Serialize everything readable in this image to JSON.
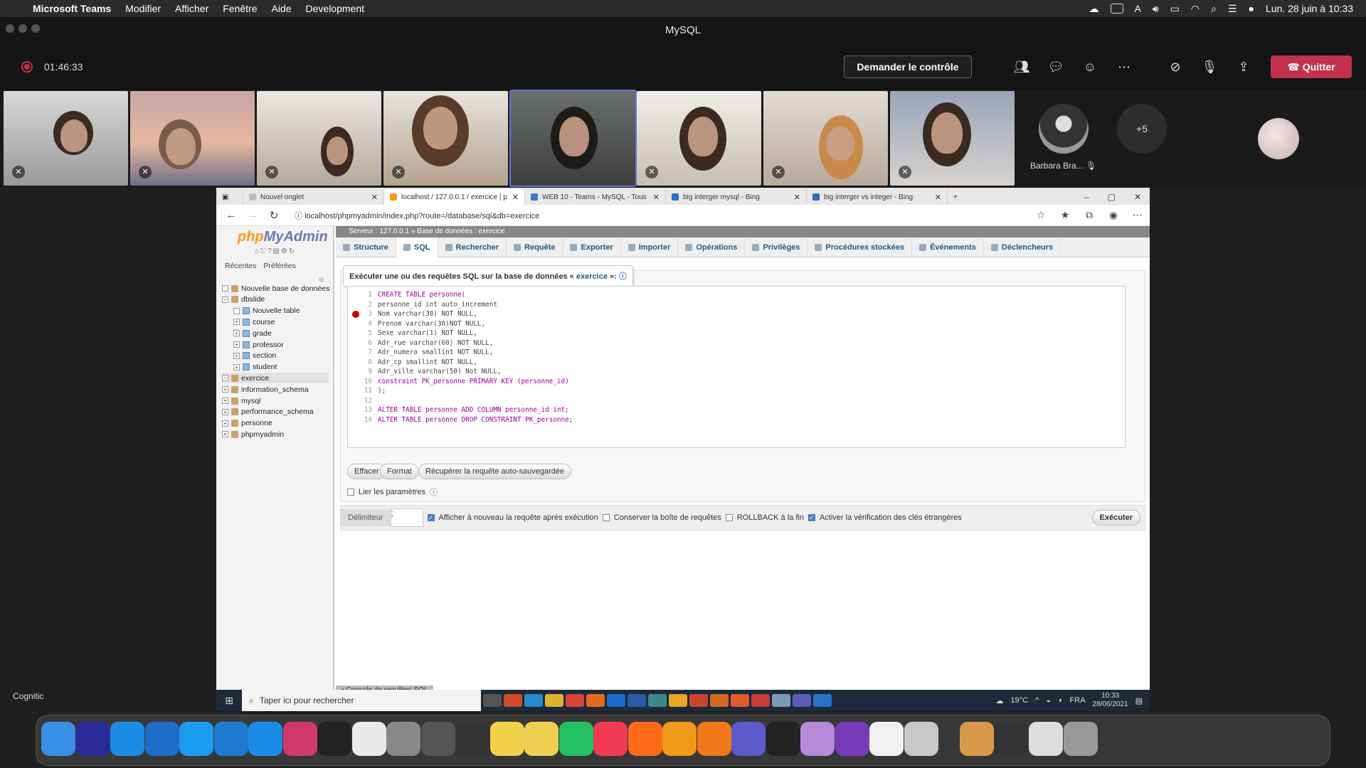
{
  "menubar": {
    "app": "Microsoft Teams",
    "items": [
      "Modifier",
      "Afficher",
      "Fenêtre",
      "Aide",
      "Development"
    ],
    "datetime": "Lun. 28 juin à  10:33"
  },
  "teams": {
    "window_title": "MySQL",
    "timer": "01:46:33",
    "request_control": "Demander le contrôle",
    "quit": "Quitter",
    "plus_count": "+5",
    "participant_name": "Barbara Bra...",
    "org_label": "Cognitic"
  },
  "browser": {
    "tabs": [
      {
        "label": "Nouvel onglet"
      },
      {
        "label": "localhost / 127.0.0.1 / exercice | p"
      },
      {
        "label": "WEB 10 - Teams - MySQL - Tous"
      },
      {
        "label": "big interger mysql - Bing"
      },
      {
        "label": "big interger vs integer - Bing"
      }
    ],
    "url": "localhost/phpmyadmin/index.php?route=/database/sql&db=exercice"
  },
  "pma": {
    "logo_php": "php",
    "logo_myadmin": "MyAdmin",
    "recent": "Récentes",
    "favorites": "Préférées",
    "tree": [
      {
        "label": "Nouvelle base de données",
        "level": 0
      },
      {
        "label": "dbslide",
        "level": 0
      },
      {
        "label": "Nouvelle table",
        "level": 1
      },
      {
        "label": "course",
        "level": 1
      },
      {
        "label": "grade",
        "level": 1
      },
      {
        "label": "professor",
        "level": 1
      },
      {
        "label": "section",
        "level": 1
      },
      {
        "label": "student",
        "level": 1
      },
      {
        "label": "exercice",
        "level": 0
      },
      {
        "label": "information_schema",
        "level": 0
      },
      {
        "label": "mysql",
        "level": 0
      },
      {
        "label": "performance_schema",
        "level": 0
      },
      {
        "label": "personne",
        "level": 0
      },
      {
        "label": "phpmyadmin",
        "level": 0
      }
    ],
    "breadcrumb": "Serveur : 127.0.0.1  »  Base de données : exercice",
    "nav": [
      "Structure",
      "SQL",
      "Rechercher",
      "Requête",
      "Exporter",
      "Importer",
      "Opérations",
      "Privilèges",
      "Procédures stockées",
      "Événements",
      "Déclencheurs"
    ],
    "legend_prefix": "Exécuter une ou des requêtes SQL sur la base de données «",
    "legend_db": "exercice",
    "legend_suffix": "»:",
    "code_lines": [
      "CREATE TABLE personne(",
      "personne_id int auto_increment",
      "Nom varchar(30) NOT NULL,",
      "Prenom varchar(30)NOT NULL,",
      "Sexe varchar(1) NOT NULL,",
      "Adr_rue varchar(60) NOT NULL,",
      "Adr_numero smallint NOT NULL,",
      "Adr_cp smallint NOT NULL,",
      "Adr_ville varchar(50) Not NULL,",
      "constraint PK_personne PRIMARY KEY (personne_id)",
      ");",
      "",
      "ALTER TABLE personne ADD COLUMN personne_id int;",
      "ALTER TABLE personne DROP CONSTRAINT PK_personne;"
    ],
    "btn_clear": "Effacer",
    "btn_format": "Format",
    "btn_restore": "Récupérer la requête auto-sauvegardée",
    "bind_params": "Lier les paramètres",
    "delimiter_label": "Délimiteur",
    "delimiter_value": ";",
    "opt_show_again": "Afficher à nouveau la requête après exécution",
    "opt_keep_box": "Conserver la boîte de requêtes",
    "opt_rollback": "ROLLBACK à la fin",
    "opt_fk_check": "Activer la vérification des clés étrangères",
    "exec": "Exécuter",
    "console": "Console de requêtes SQL"
  },
  "windows": {
    "search_placeholder": "Taper ici pour rechercher",
    "weather": "19°C",
    "lang": "FRA",
    "time": "10:33",
    "date": "28/06/2021"
  }
}
